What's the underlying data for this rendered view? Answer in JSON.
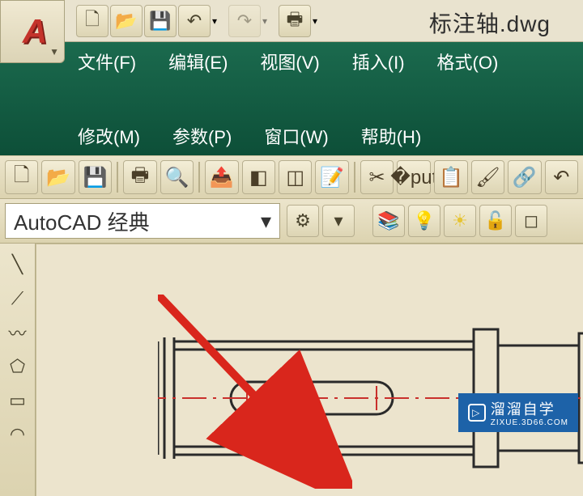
{
  "app": {
    "logo_letter": "A",
    "doc_title": "标注轴.dwg"
  },
  "qat": {
    "new": "new-file-icon",
    "open": "open-folder-icon",
    "save": "save-icon",
    "undo": "undo-icon",
    "redo": "redo-icon",
    "print": "print-icon"
  },
  "menubar": {
    "row1": [
      {
        "label": "文件(F)",
        "name": "menu-file"
      },
      {
        "label": "编辑(E)",
        "name": "menu-edit"
      },
      {
        "label": "视图(V)",
        "name": "menu-view"
      },
      {
        "label": "插入(I)",
        "name": "menu-insert"
      },
      {
        "label": "格式(O)",
        "name": "menu-format"
      }
    ],
    "row2": [
      {
        "label": "修改(M)",
        "name": "menu-modify"
      },
      {
        "label": "参数(P)",
        "name": "menu-parametric"
      },
      {
        "label": "窗口(W)",
        "name": "menu-window"
      },
      {
        "label": "帮助(H)",
        "name": "menu-help"
      }
    ]
  },
  "workspace_combo": {
    "label": "AutoCAD 经典",
    "chev": "▾"
  },
  "watermark": {
    "brand": "溜溜自学",
    "sub": "ZIXUE.3D66.COM",
    "play": "▷"
  },
  "colors": {
    "menu_bg": "#0d4f38",
    "arrow": "#d9261c",
    "watermark_bg": "#1d62a8"
  }
}
